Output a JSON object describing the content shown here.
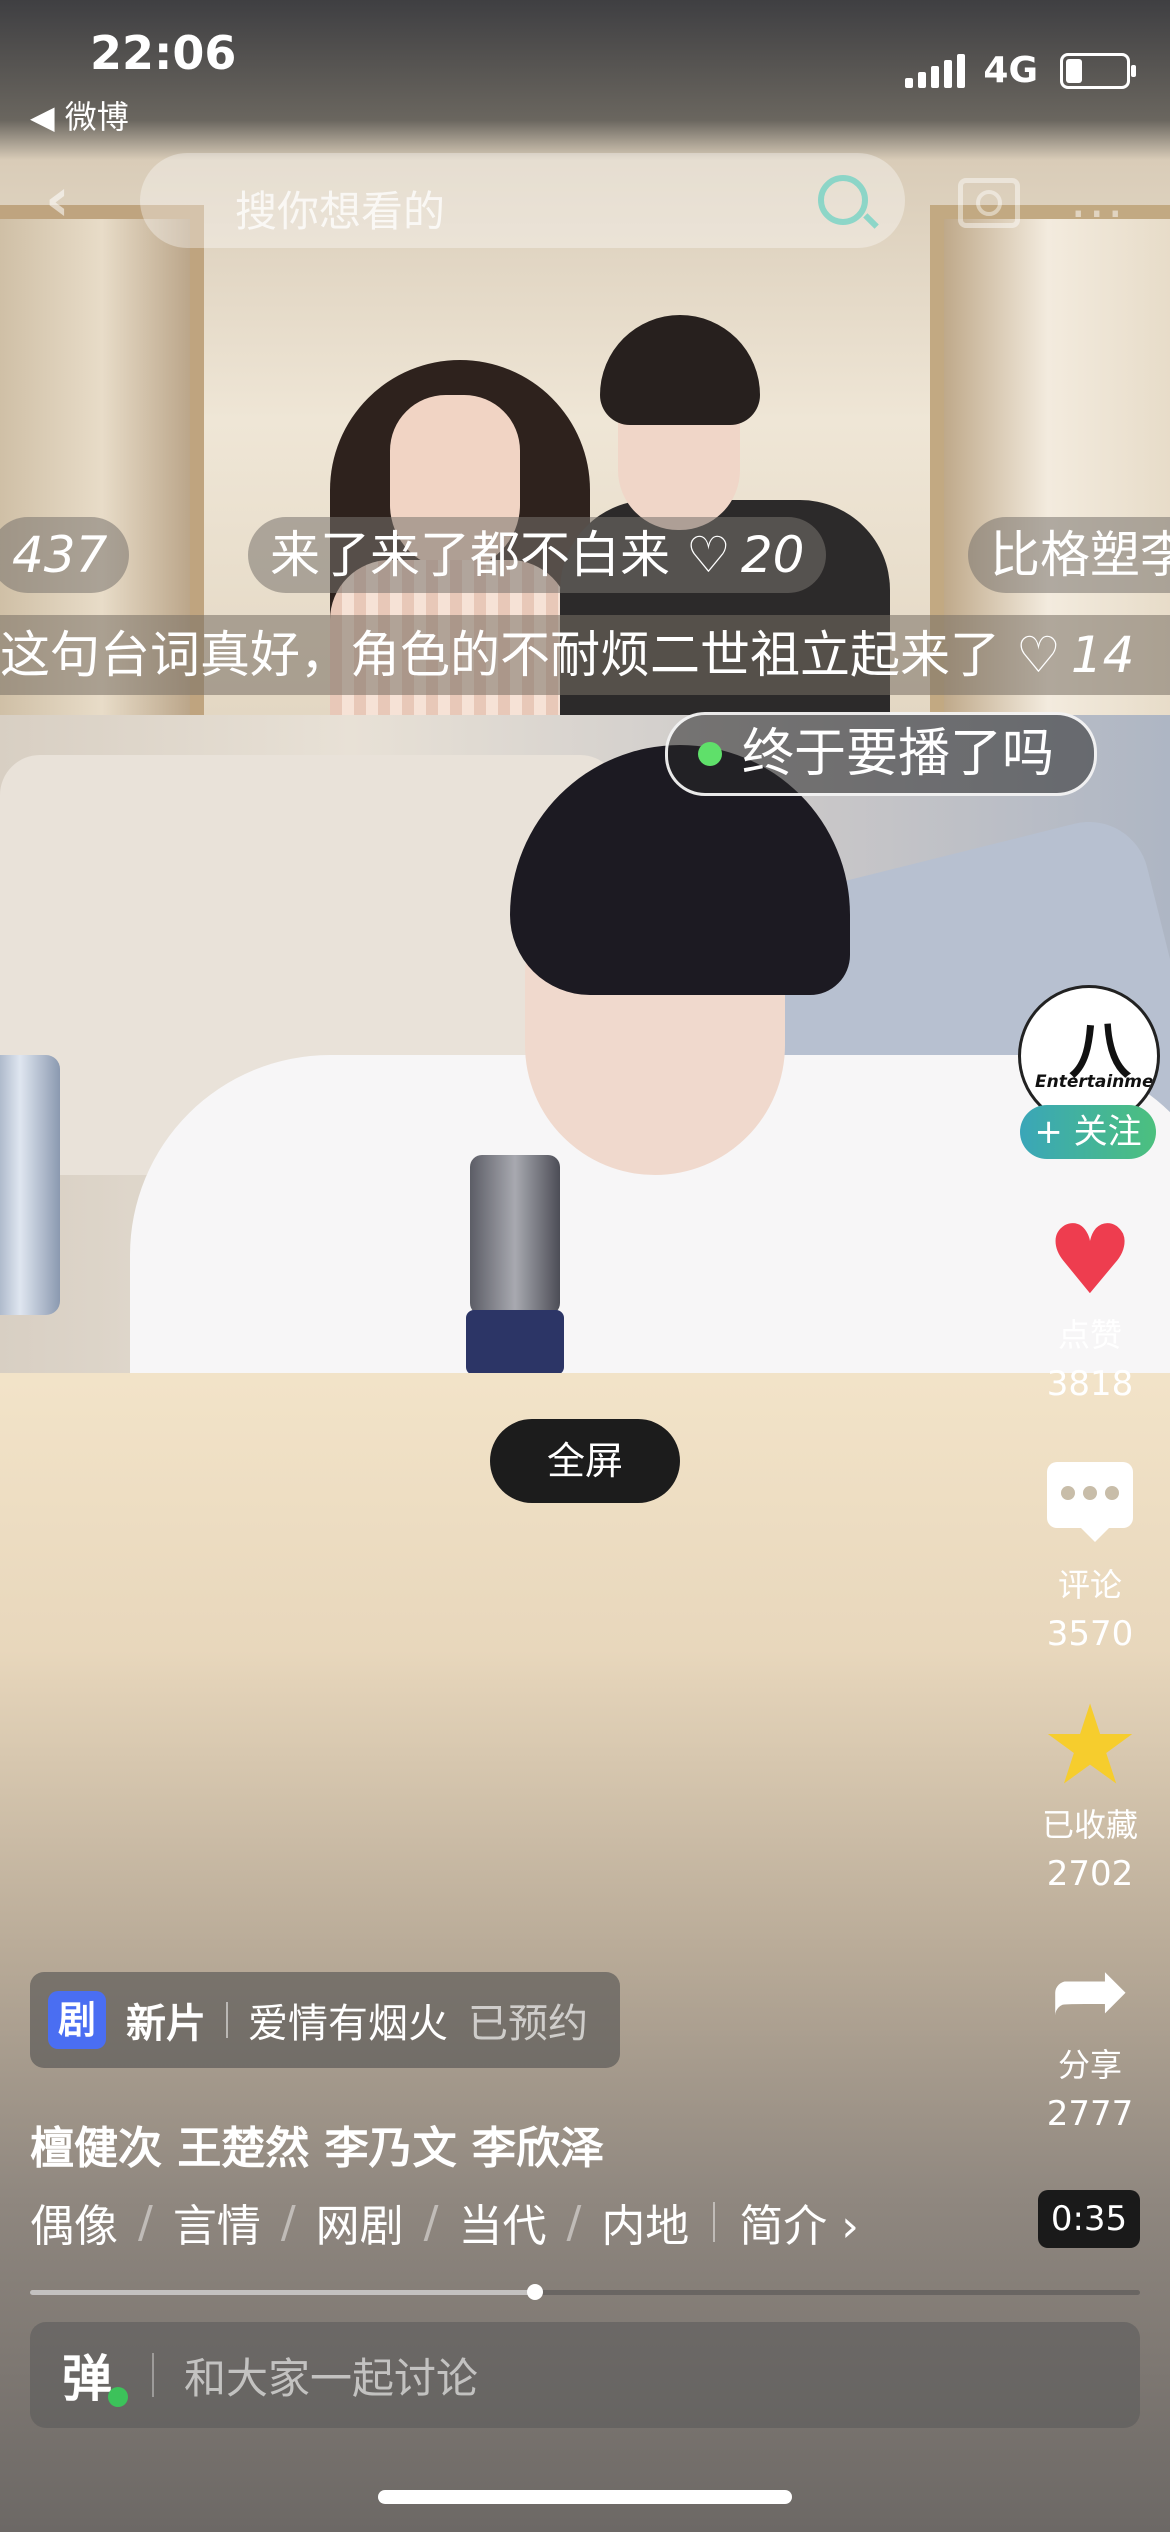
{
  "status_bar": {
    "time": "22:06",
    "back_app": "◀ 微博",
    "network": "4G"
  },
  "nav": {
    "back_icon": "‹",
    "search_placeholder": "搜你想看的",
    "more_icon": "···"
  },
  "danmaku": [
    {
      "text": "",
      "likes": "437"
    },
    {
      "text": "来了来了都不白来",
      "likes": "20"
    },
    {
      "text": "比格塑李",
      "likes": ""
    },
    {
      "text": "这句台词真好，角色的不耐烦二世祖立起来了",
      "likes": "14"
    }
  ],
  "heart_glyph": "♡",
  "topic_pill": "终于要播了吗",
  "creator": {
    "avatar_mark": "八",
    "avatar_text": "Entertainment",
    "follow_label": "+ 关注"
  },
  "actions": {
    "like": {
      "icon": "heart-icon",
      "label": "点赞",
      "count": "3818"
    },
    "comment": {
      "icon": "comment-icon",
      "label": "评论",
      "count": "3570"
    },
    "favorite": {
      "icon": "star-icon",
      "label": "已收藏",
      "count": "2702"
    },
    "share": {
      "icon": "share-icon",
      "label": "分享",
      "count": "2777"
    }
  },
  "fullscreen_label": "全屏",
  "drama": {
    "tag": "剧",
    "new_label": "新片",
    "title": "爱情有烟火",
    "booked": "已预约"
  },
  "cast": "檀健次 王楚然 李乃文 李欣泽",
  "tags": [
    "偶像",
    "言情",
    "网剧",
    "当代",
    "内地"
  ],
  "intro_label": "简介 ›",
  "duration": "0:35",
  "progress_fraction": 0.455,
  "comment_bar": {
    "danmu_label": "弹",
    "placeholder": "和大家一起讨论"
  },
  "colors": {
    "like_red": "#ee3d4f",
    "favorite_yellow": "#f6cd2d",
    "follow_green": "#4cc07e",
    "drama_tag_blue": "#4a6ef2",
    "page_background": "#f2e3c8"
  }
}
